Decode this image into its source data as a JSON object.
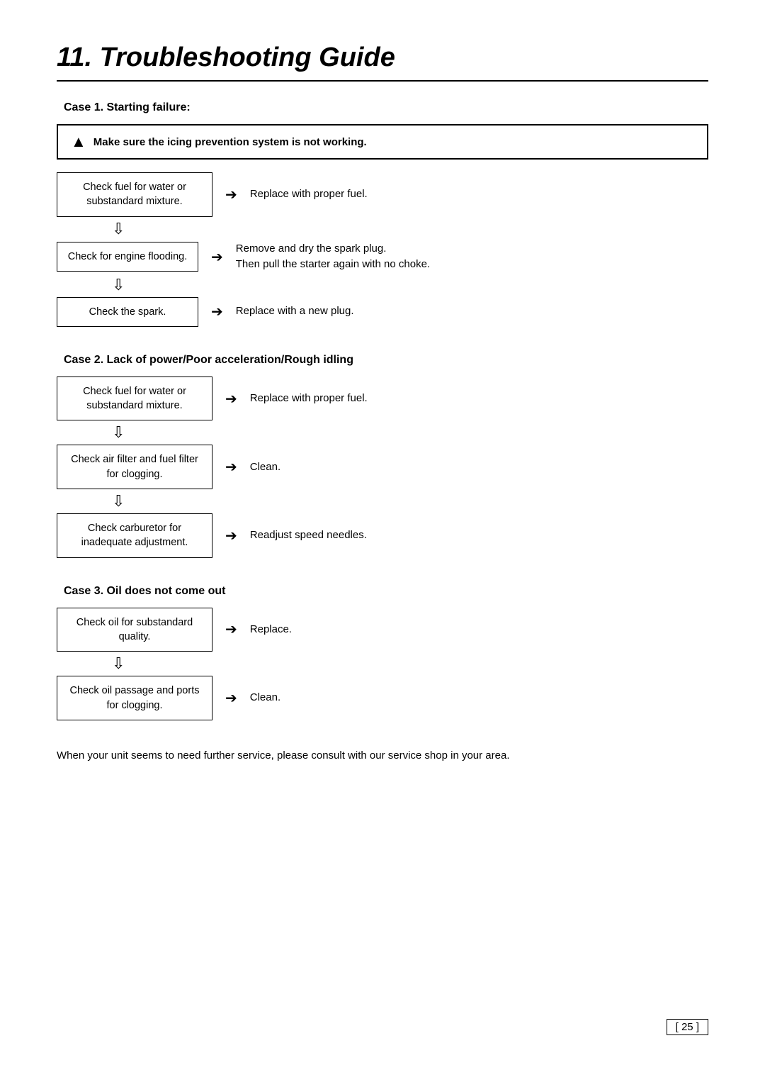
{
  "page": {
    "title": "11. Troubleshooting Guide",
    "page_number": "25"
  },
  "case1": {
    "title": "Case 1. Starting failure:",
    "warning": "Make sure the icing prevention system is not working.",
    "steps": [
      {
        "box": "Check fuel for water or substandard mixture.",
        "action": "Replace with proper fuel."
      },
      {
        "box": "Check for engine flooding.",
        "action": "Remove and dry the spark plug.\nThen pull the starter again with no choke."
      },
      {
        "box": "Check the spark.",
        "action": "Replace with a new plug."
      }
    ]
  },
  "case2": {
    "title": "Case 2. Lack of power/Poor acceleration/Rough idling",
    "steps": [
      {
        "box": "Check fuel for water or substandard mixture.",
        "action": "Replace with proper fuel."
      },
      {
        "box": "Check air filter and fuel filter for clogging.",
        "action": "Clean."
      },
      {
        "box": "Check carburetor for inadequate adjustment.",
        "action": "Readjust speed needles."
      }
    ]
  },
  "case3": {
    "title": "Case 3. Oil does not come out",
    "steps": [
      {
        "box": "Check oil for substandard quality.",
        "action": "Replace."
      },
      {
        "box": "Check oil passage and ports for clogging.",
        "action": "Clean."
      }
    ]
  },
  "footer": {
    "text": "When your unit seems to need further service, please consult with our service shop in your area."
  }
}
